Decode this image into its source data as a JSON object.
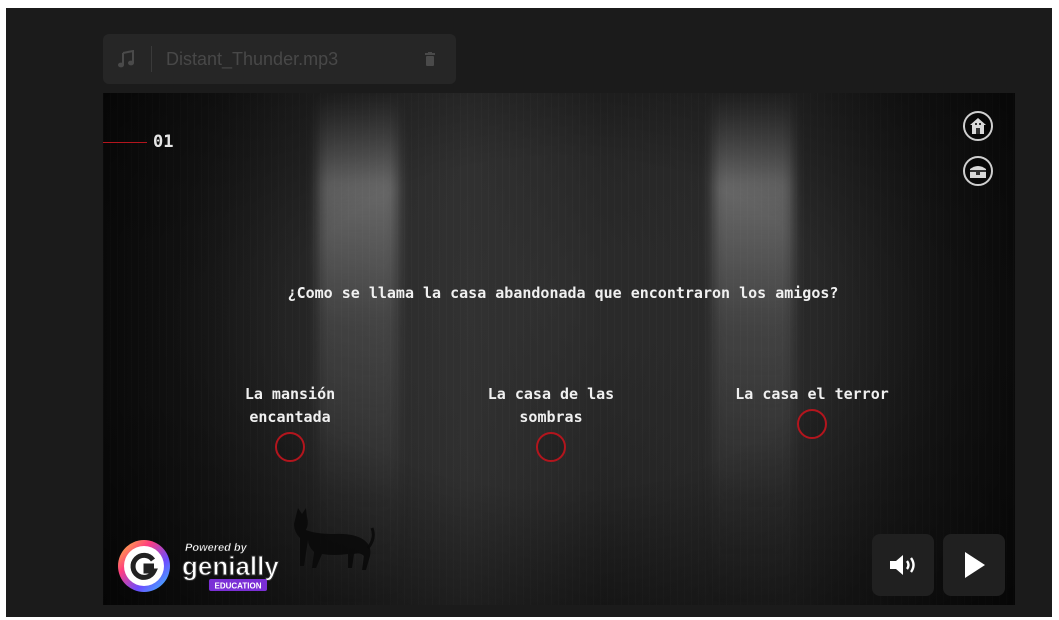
{
  "audio": {
    "filename": "Distant_Thunder.mp3",
    "icon": "music-note-icon",
    "delete_icon": "trash-icon"
  },
  "slide": {
    "question_number": "01",
    "question": "¿Como se llama la casa abandonada que encontraron los amigos?",
    "answers": [
      {
        "label": "La mansión encantada"
      },
      {
        "label": "La casa de las sombras"
      },
      {
        "label": "La casa el terror"
      }
    ],
    "top_right_icons": [
      "home-icon",
      "chest-icon"
    ],
    "decoration": "cat-silhouette-icon"
  },
  "branding": {
    "powered_by": "Powered by",
    "name": "genially",
    "badge": "EDUCATION"
  },
  "controls": {
    "volume_icon": "volume-icon",
    "play_icon": "play-icon"
  },
  "colors": {
    "accent_red": "#b3151d",
    "text": "#f0f0f0",
    "background": "#1b1b1b",
    "education_badge": "#7b2fd6"
  }
}
